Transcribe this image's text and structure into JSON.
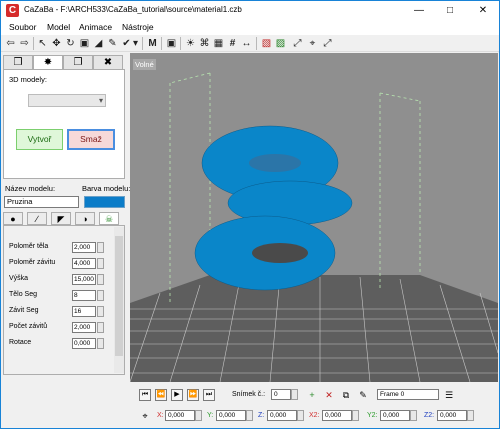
{
  "window": {
    "app_icon": "C",
    "title": "CaZaBa - F:\\ARCH533\\CaZaBa_tutorial\\source\\material1.czb",
    "minimize_glyph": "—",
    "maximize_glyph": "□",
    "close_glyph": "✕"
  },
  "menu": {
    "items": [
      "Soubor",
      "Model",
      "Animace",
      "Nástroje"
    ]
  },
  "toolbar": {
    "glyphs": {
      "back": "⇦",
      "forward": "⇨",
      "pointer": "↖",
      "move": "✥",
      "rotate": "↻",
      "scale": "▣",
      "shear": "◢",
      "pencil": "✎",
      "check": "✔",
      "dropdown": "▾",
      "material": "M",
      "camera": "▣",
      "light": "☀",
      "tree": "⌘",
      "grid": "▦",
      "hash": "#",
      "spacer": "↔",
      "render1": "▧",
      "render2": "▨",
      "fit": "⤢",
      "zoom": "⌖"
    }
  },
  "left_panel": {
    "tabs": [
      "❒",
      "✸",
      "❐",
      "✖"
    ],
    "models_label": "3D modely:",
    "combo_arrow": "▾",
    "create_button": "Vytvoř",
    "delete_button": "Smaž",
    "model_name_label": "Název modelu:",
    "model_color_label": "Barva modelu:",
    "model_name": "Pruzina",
    "model_color": "#0b7cc8",
    "subtabs": [
      "●",
      "∕",
      "◤",
      "◑",
      "☠"
    ],
    "params": [
      {
        "label": "Poloměr těla",
        "value": "2,000"
      },
      {
        "label": "Poloměr závitu",
        "value": "4,000"
      },
      {
        "label": "Výška",
        "value": "15,000"
      },
      {
        "label": "Tělo Seg",
        "value": "8"
      },
      {
        "label": "Závit Seg",
        "value": "16"
      },
      {
        "label": "Počet závitů",
        "value": "2,000"
      },
      {
        "label": "Rotace",
        "value": "0,000"
      }
    ],
    "spin_glyph": "▴▾"
  },
  "viewport": {
    "mode_label": "Volné",
    "mode_caret": "▾",
    "object_color": "#0a86c9"
  },
  "frame_bar": {
    "nav": [
      "⏮",
      "⏪",
      "▶",
      "⏩",
      "⏭"
    ],
    "frame_label": "Snímek č.:",
    "frame_value": "0",
    "frame_name": "Frame 0",
    "coords": [
      {
        "label": "X:",
        "value": "0,000",
        "color": "#d03030"
      },
      {
        "label": "Y:",
        "value": "0,000",
        "color": "#2a9a2a"
      },
      {
        "label": "Z:",
        "value": "0,000",
        "color": "#2040c0"
      },
      {
        "label": "X2:",
        "value": "0,000",
        "color": "#d03030"
      },
      {
        "label": "Y2:",
        "value": "0,000",
        "color": "#2a9a2a"
      },
      {
        "label": "Z2:",
        "value": "0,000",
        "color": "#2040c0"
      }
    ]
  }
}
